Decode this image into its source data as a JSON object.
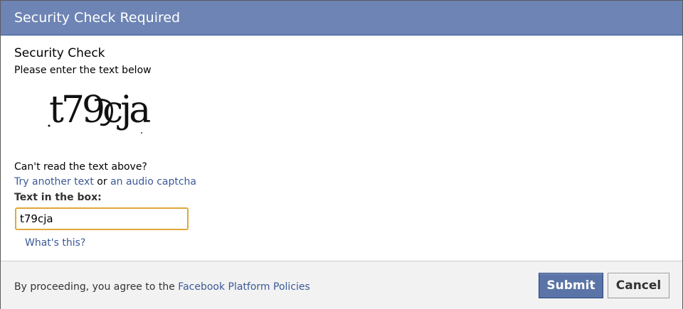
{
  "dialog": {
    "title": "Security Check Required"
  },
  "security_check": {
    "heading": "Security Check",
    "instruction": "Please enter the text below",
    "captcha_text": "t79cja",
    "cant_read": "Can't read the text above?",
    "try_another_text": "Try another text",
    "or_text": " or ",
    "audio_captcha_link": "an audio captcha",
    "field_label": "Text in the box:",
    "field_value": "t79cja",
    "whats_this_link": "What's this?"
  },
  "footer": {
    "policy_prefix": "By proceeding, you agree to the ",
    "policy_link": "Facebook Platform Policies",
    "submit_label": "Submit",
    "cancel_label": "Cancel"
  },
  "colors": {
    "title_bar": "#6d84b4",
    "link": "#3b5998",
    "input_focus_border": "#e0a93a",
    "submit_button": "#5b74a8",
    "footer_background": "#f2f2f2"
  }
}
